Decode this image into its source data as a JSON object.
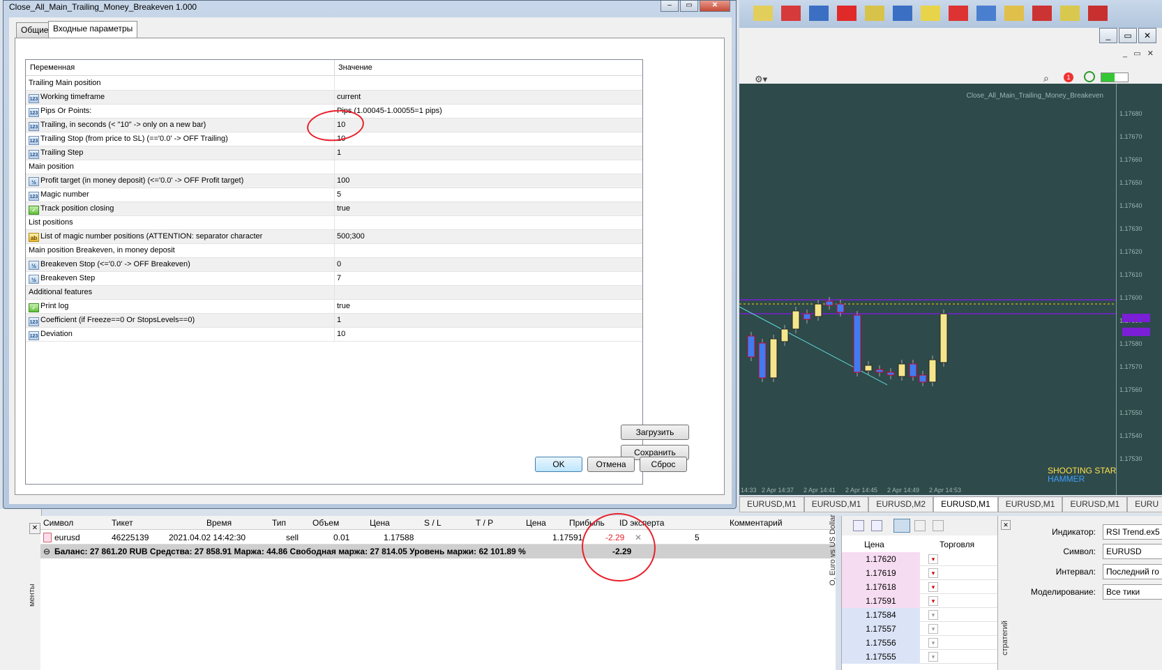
{
  "dialog": {
    "title": "Close_All_Main_Trailing_Money_Breakeven 1.000",
    "tabs": [
      "Общие",
      "Входные параметры"
    ],
    "grid_header": {
      "variable": "Переменная",
      "value": "Значение"
    },
    "rows": [
      {
        "name": "Trailing Main position",
        "value": "",
        "icon": "none"
      },
      {
        "name": "Working timeframe",
        "value": "current",
        "icon": "123"
      },
      {
        "name": "Pips Or Points:",
        "value": "Pips (1.00045-1.00055=1 pips)",
        "icon": "123"
      },
      {
        "name": "Trailing, in seconds (< \"10\" -> only on a new bar)",
        "value": "10",
        "icon": "123"
      },
      {
        "name": "Trailing Stop (from price to SL) (=='0.0' -> OFF Trailing)",
        "value": "10",
        "icon": "123"
      },
      {
        "name": "Trailing Step",
        "value": "1",
        "icon": "123"
      },
      {
        "name": "Main position",
        "value": "",
        "icon": "none"
      },
      {
        "name": "Profit target (in money deposit) (<='0.0' -> OFF Profit target)",
        "value": "100",
        "icon": "frac"
      },
      {
        "name": "Magic number",
        "value": "5",
        "icon": "123"
      },
      {
        "name": "Track position closing",
        "value": "true",
        "icon": "bool"
      },
      {
        "name": "List positions",
        "value": "",
        "icon": "none"
      },
      {
        "name": "List of magic number positions (ATTENTION: separator character",
        "value": "500;300",
        "icon": "str"
      },
      {
        "name": "Main position Breakeven, in money deposit",
        "value": "",
        "icon": "none"
      },
      {
        "name": "Breakeven Stop (<='0.0' -> OFF Breakeven)",
        "value": "0",
        "icon": "frac"
      },
      {
        "name": "Breakeven Step",
        "value": "7",
        "icon": "frac"
      },
      {
        "name": "Additional features",
        "value": "",
        "icon": "none"
      },
      {
        "name": "Print log",
        "value": "true",
        "icon": "bool"
      },
      {
        "name": "Coefficient (if Freeze==0 Or StopsLevels==0)",
        "value": "1",
        "icon": "123"
      },
      {
        "name": "Deviation",
        "value": "10",
        "icon": "123"
      }
    ],
    "buttons": {
      "load": "Загрузить",
      "save": "Сохранить",
      "ok": "OK",
      "cancel": "Отмена",
      "reset": "Сброс"
    }
  },
  "chart": {
    "title": "Close_All_Main_Trailing_Money_Breakeven",
    "price_ticks": [
      "1.17680",
      "1.17670",
      "1.17660",
      "1.17650",
      "1.17640",
      "1.17630",
      "1.17620",
      "1.17610",
      "1.17600",
      "1.17590",
      "1.17580",
      "1.17570",
      "1.17560",
      "1.17550",
      "1.17540",
      "1.17530"
    ],
    "time_ticks": [
      "14:33",
      "2 Apr 14:37",
      "2 Apr 14:41",
      "2 Apr 14:45",
      "2 Apr 14:49",
      "2 Apr 14:53"
    ],
    "pattern_labels": {
      "shooting_star": "SHOOTING STAR",
      "hammer": "HAMMER"
    },
    "tabs": [
      "EURUSD,M1",
      "EURUSD,M1",
      "EURUSD,M2",
      "EURUSD,M1",
      "EURUSD,M1",
      "EURUSD,M1",
      "EURU"
    ],
    "active_tab": 3
  },
  "toolbox": {
    "headers": [
      "Символ",
      "Тикет",
      "Время",
      "Тип",
      "Объем",
      "Цена",
      "S / L",
      "T / P",
      "Цена",
      "Прибыль",
      "ID эксперта",
      "Комментарий"
    ],
    "row": {
      "symbol": "eurusd",
      "ticket": "46225139",
      "time": "2021.04.02 14:42:30",
      "type": "sell",
      "volume": "0.01",
      "price": "1.17588",
      "sl": "",
      "tp": "",
      "cur_price": "1.17591",
      "profit": "-2.29",
      "expert_id": "5",
      "comment": ""
    },
    "balance_text": "Баланс: 27 861.20 RUB  Средства: 27 858.91  Маржа: 44.86  Свободная маржа: 27 814.05  Уровень маржи: 62 101.89 %",
    "balance_profit": "-2.29"
  },
  "depth": {
    "headers": {
      "price": "Цена",
      "trade": "Торговля"
    },
    "vertical_label": "O, Euro vs US Dollar",
    "rows": [
      "1.17620",
      "1.17619",
      "1.17618",
      "1.17591",
      "1.17584",
      "1.17557",
      "1.17556",
      "1.17555"
    ]
  },
  "tester": {
    "labels": {
      "indicator": "Индикатор:",
      "symbol": "Символ:",
      "interval": "Интервал:",
      "modeling": "Моделирование:"
    },
    "values": {
      "indicator": "RSI Trend.ex5",
      "symbol": "EURUSD",
      "interval": "Последний го",
      "modeling": "Все тики"
    },
    "vertical_label": "стратегий"
  },
  "left_panel": {
    "label": "менты"
  },
  "colors": {
    "chart_bg": "#2e4a4a",
    "bull": "#f5e68c",
    "bear": "#3e7cf0",
    "annotation": "#e8202a",
    "loss": "#e8202a"
  }
}
